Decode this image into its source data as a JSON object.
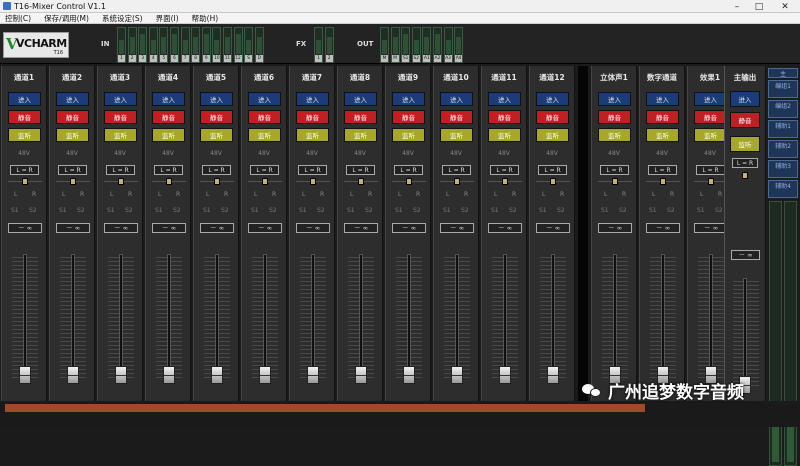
{
  "window": {
    "title": "T16-Mixer Control V1.1"
  },
  "menu": [
    "控制(C)",
    "保存/调用(M)",
    "系统设定(S)",
    "界面(I)",
    "帮助(H)"
  ],
  "logo": {
    "brand": "VCHARM",
    "model": "T16"
  },
  "top": {
    "in_label": "IN",
    "in_meters": [
      "1",
      "2",
      "3",
      "4",
      "5",
      "6",
      "7",
      "8",
      "9",
      "10",
      "11",
      "12",
      "S",
      "D"
    ],
    "fx_label": "FX",
    "fx_meters": [
      "1",
      "2"
    ],
    "out_label": "OUT",
    "out_meters": [
      "M",
      "M",
      "S1",
      "S2",
      "A1",
      "A2",
      "A3",
      "A4"
    ]
  },
  "channels": [
    {
      "name": "通道1"
    },
    {
      "name": "通道2"
    },
    {
      "name": "通道3"
    },
    {
      "name": "通道4"
    },
    {
      "name": "通道5"
    },
    {
      "name": "通道6"
    },
    {
      "name": "通道7"
    },
    {
      "name": "通道8"
    },
    {
      "name": "通道9"
    },
    {
      "name": "通道10"
    },
    {
      "name": "通道11"
    },
    {
      "name": "通道12"
    },
    {
      "name": "立体声1"
    },
    {
      "name": "数字通道"
    },
    {
      "name": "效果1"
    }
  ],
  "strip_labels": {
    "in": "进入",
    "mute": "静音",
    "solo": "监听",
    "phantom": "48V",
    "link": "L = R",
    "l": "L",
    "r": "R",
    "s1": "S1",
    "s2": "S2",
    "level": "－ ∞"
  },
  "master": {
    "name": "主输出",
    "in": "进入",
    "mute": "静音",
    "solo": "监听",
    "link": "L = R",
    "level": "－ ∞"
  },
  "bus_list": [
    "主",
    "编组1",
    "编组2",
    "辅助1",
    "辅助2",
    "辅助3",
    "辅助4"
  ],
  "watermark": "广州追梦数字音频",
  "colors": {
    "in": "#1a3d7a",
    "mute": "#c01f24",
    "solo": "#a5a82a",
    "logo_v": "#1d8b2a"
  }
}
